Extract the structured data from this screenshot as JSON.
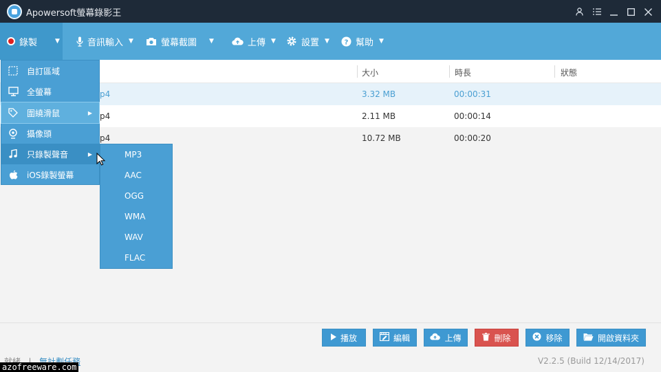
{
  "window": {
    "title": "Apowersoft螢幕錄影王"
  },
  "toolbar": {
    "record": "錄製",
    "audio_input": "音訊輸入",
    "screenshot": "螢幕截圖",
    "upload": "上傳",
    "settings": "設置",
    "help": "幫助"
  },
  "table": {
    "headers": {
      "size": "大小",
      "duration": "時長",
      "status": "狀態"
    },
    "rows": [
      {
        "name": "p4",
        "size": "3.32 MB",
        "duration": "00:00:31"
      },
      {
        "name": "p4",
        "size": "2.11 MB",
        "duration": "00:00:14"
      },
      {
        "name": "p4",
        "size": "10.72 MB",
        "duration": "00:00:20"
      }
    ]
  },
  "record_menu": {
    "items": [
      {
        "label": "自訂區域",
        "icon": "region-select-icon"
      },
      {
        "label": "全螢幕",
        "icon": "monitor-icon"
      },
      {
        "label": "圍繞滑鼠",
        "icon": "mouse-tag-icon"
      },
      {
        "label": "攝像頭",
        "icon": "webcam-icon"
      },
      {
        "label": "只錄製聲音",
        "icon": "music-note-icon"
      },
      {
        "label": "iOS錄製螢幕",
        "icon": "apple-icon"
      }
    ]
  },
  "audio_submenu": {
    "items": [
      "MP3",
      "AAC",
      "OGG",
      "WMA",
      "WAV",
      "FLAC"
    ]
  },
  "bottom": {
    "play": "播放",
    "edit": "編輯",
    "upload": "上傳",
    "delete": "刪除",
    "remove": "移除",
    "open_folder": "開啟資料夾",
    "status": "就緒",
    "schedule_link": "無計劃任務",
    "version": "V2.2.5 (Build 12/14/2017)"
  },
  "watermark": "azofreeware.com",
  "colors": {
    "titlebar": "#1e2a38",
    "toolbar": "#52a8d8",
    "accent": "#3f99d2",
    "danger": "#d9534f"
  }
}
